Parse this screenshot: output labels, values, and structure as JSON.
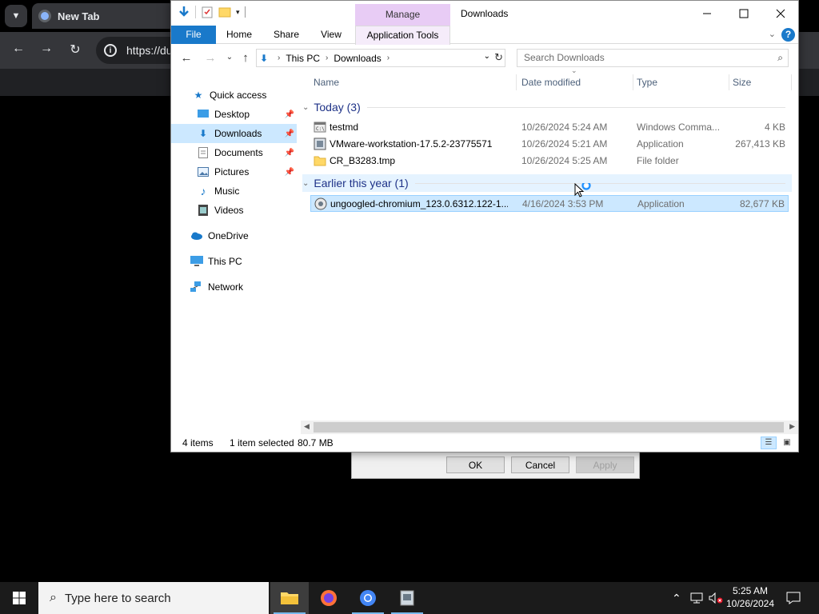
{
  "chrome": {
    "tab_title": "New Tab",
    "url_partial": "https://du"
  },
  "explorer": {
    "title": "Downloads",
    "ribbon": {
      "contextual_header": "Manage",
      "tabs": [
        "File",
        "Home",
        "Share",
        "View",
        "Application Tools"
      ]
    },
    "address": {
      "crumbs": [
        "This PC",
        "Downloads"
      ]
    },
    "search_placeholder": "Search Downloads",
    "nav": {
      "quick_access": "Quick access",
      "items": [
        {
          "label": "Desktop",
          "pinned": true
        },
        {
          "label": "Downloads",
          "pinned": true,
          "selected": true
        },
        {
          "label": "Documents",
          "pinned": true
        },
        {
          "label": "Pictures",
          "pinned": true
        },
        {
          "label": "Music",
          "pinned": false
        },
        {
          "label": "Videos",
          "pinned": false
        }
      ],
      "onedrive": "OneDrive",
      "this_pc": "This PC",
      "network": "Network"
    },
    "columns": [
      "Name",
      "Date modified",
      "Type",
      "Size"
    ],
    "groups": [
      {
        "label": "Today (3)",
        "files": [
          {
            "name": "testmd",
            "date": "10/26/2024 5:24 AM",
            "type": "Windows Comma...",
            "size": "4 KB",
            "icon": "cmd-file-icon"
          },
          {
            "name": "VMware-workstation-17.5.2-23775571",
            "date": "10/26/2024 5:21 AM",
            "type": "Application",
            "size": "267,413 KB",
            "icon": "installer-icon"
          },
          {
            "name": "CR_B3283.tmp",
            "date": "10/26/2024 5:25 AM",
            "type": "File folder",
            "size": "",
            "icon": "folder-icon"
          }
        ]
      },
      {
        "label": "Earlier this year (1)",
        "files": [
          {
            "name": "ungoogled-chromium_123.0.6312.122-1....",
            "date": "4/16/2024 3:53 PM",
            "type": "Application",
            "size": "82,677 KB",
            "icon": "installer-icon",
            "selected": true
          }
        ]
      }
    ],
    "status": {
      "count": "4 items",
      "selection": "1 item selected",
      "size": "80.7 MB"
    }
  },
  "props_dialog": {
    "ok": "OK",
    "cancel": "Cancel",
    "apply": "Apply"
  },
  "taskbar": {
    "search_placeholder": "Type here to search",
    "time": "5:25 AM",
    "date": "10/26/2024"
  }
}
